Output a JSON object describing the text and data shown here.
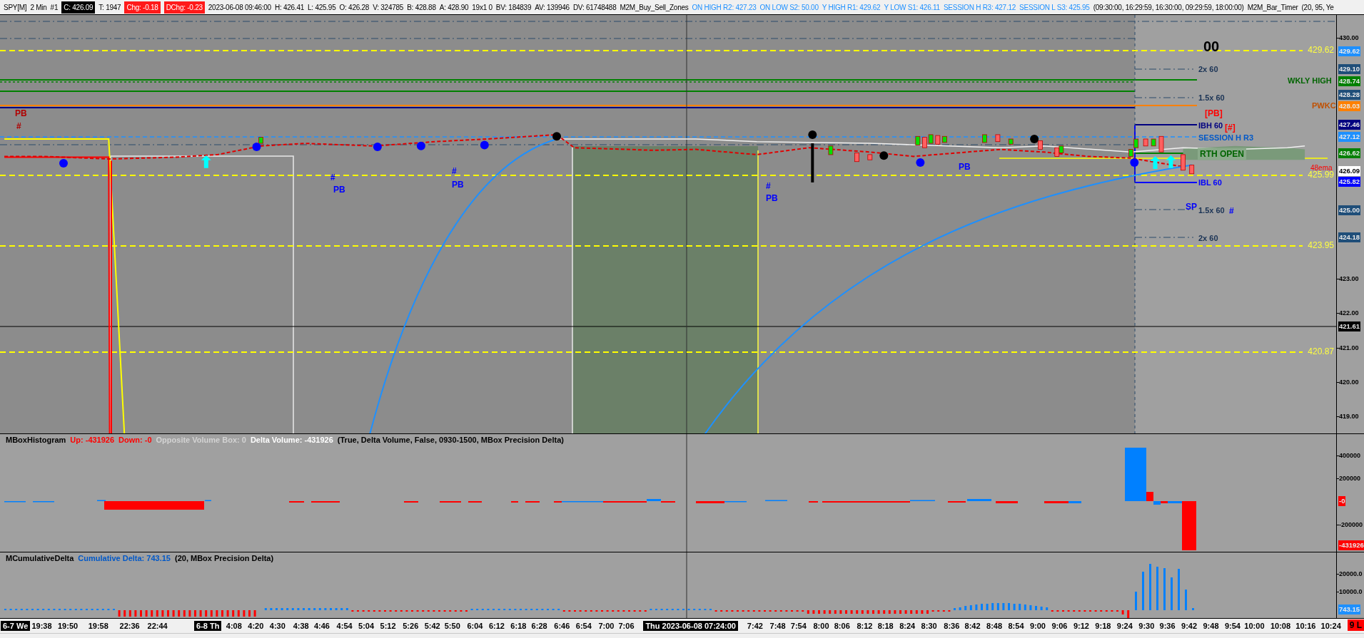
{
  "header": {
    "items": [
      {
        "text": "SPY[M]",
        "kind": "text"
      },
      {
        "text": "2 Min",
        "kind": "text"
      },
      {
        "text": "#1",
        "kind": "text"
      },
      {
        "text": "C: 426.09",
        "kind": "dark"
      },
      {
        "text": "T: 1947",
        "kind": "text"
      },
      {
        "text": "Chg: -0.18",
        "kind": "red"
      },
      {
        "text": "DChg: -0.23",
        "kind": "red"
      },
      {
        "text": "2023-06-08 09:46:00",
        "kind": "text"
      },
      {
        "text": "H: 426.41",
        "kind": "text"
      },
      {
        "text": "L: 425.95",
        "kind": "text"
      },
      {
        "text": "O: 426.28",
        "kind": "text"
      },
      {
        "text": "V: 324785",
        "kind": "text"
      },
      {
        "text": "B: 428.88",
        "kind": "text"
      },
      {
        "text": "A: 428.90",
        "kind": "text"
      },
      {
        "text": "19x1 0",
        "kind": "text"
      },
      {
        "text": "BV: 184839",
        "kind": "text"
      },
      {
        "text": "AV: 139946",
        "kind": "text"
      },
      {
        "text": "DV: 61748488",
        "kind": "text"
      },
      {
        "text": "M2M_Buy_Sell_Zones",
        "kind": "text"
      },
      {
        "text": "ON HIGH R2: 427.23",
        "kind": "blue"
      },
      {
        "text": "ON LOW S2: 50.00",
        "kind": "blue"
      },
      {
        "text": "Y HIGH R1: 429.62",
        "kind": "blue"
      },
      {
        "text": "Y LOW S1: 426.11",
        "kind": "blue"
      },
      {
        "text": "SESSION H R3: 427.12",
        "kind": "blue"
      },
      {
        "text": "SESSION L S3: 425.95",
        "kind": "blue"
      },
      {
        "text": "(09:30:00, 16:29:59, 16:30:00, 09:29:59, 18:00:00)",
        "kind": "text"
      },
      {
        "text": "M2M_Bar_Timer",
        "kind": "text"
      },
      {
        "text": "(20, 95, Ye",
        "kind": "text"
      }
    ]
  },
  "price_pane": {
    "axis_ticks": [
      "430.00",
      "423.00",
      "422.00",
      "421.00",
      "420.00",
      "419.00"
    ],
    "price_badges": [
      {
        "text": "429.62",
        "color": "#1e90ff"
      },
      {
        "text": "429.10",
        "color": "#1f4e79"
      },
      {
        "text": "428.74",
        "color": "#008000"
      },
      {
        "text": "428.28",
        "color": "#1f4e79"
      },
      {
        "text": "428.03",
        "color": "#ff8000"
      },
      {
        "text": "427.46",
        "color": "#000080"
      },
      {
        "text": "427.12",
        "color": "#1e90ff"
      },
      {
        "text": "426.62",
        "color": "#008000"
      },
      {
        "text": "426.09",
        "color": "#ffffff"
      },
      {
        "text": "425.82",
        "color": "#0000ff"
      },
      {
        "text": "425.00",
        "color": "#1f4e79"
      },
      {
        "text": "424.18",
        "color": "#1f4e79"
      },
      {
        "text": "421.61",
        "color": "#000000"
      }
    ],
    "level_lines": [
      {
        "label": "429.62"
      },
      {
        "label": "425.99"
      },
      {
        "label": "423.95"
      },
      {
        "label": "420.87"
      }
    ],
    "labels": [
      {
        "text": "PB",
        "color": "#b00000",
        "kind": "bold"
      },
      {
        "text": "#",
        "color": "#b00000",
        "kind": "bold"
      },
      {
        "text": "#",
        "color": "#0000ff",
        "kind": "bold"
      },
      {
        "text": "PB",
        "color": "#0000ff",
        "kind": "bold"
      },
      {
        "text": "#",
        "color": "#0000ff",
        "kind": "bold"
      },
      {
        "text": "PB",
        "color": "#0000ff",
        "kind": "bold"
      },
      {
        "text": "#",
        "color": "#0000ff",
        "kind": "bold"
      },
      {
        "text": "PB",
        "color": "#0000ff",
        "kind": "bold"
      },
      {
        "text": "PB",
        "color": "#0000ff",
        "kind": "bold"
      },
      {
        "text": "00",
        "color": "#000000",
        "kind": "big"
      },
      {
        "text": "2x 60",
        "color": "#1a3355",
        "kind": "plain"
      },
      {
        "text": "WKLY HIGH",
        "color": "#006400",
        "kind": "plain"
      },
      {
        "text": "1.5x 60",
        "color": "#1a3355",
        "kind": "plain"
      },
      {
        "text": "PWKC",
        "color": "#c05000",
        "kind": "plain"
      },
      {
        "text": "[PB]",
        "color": "#ff0000",
        "kind": "bold"
      },
      {
        "text": "IBH 60",
        "color": "#000080",
        "kind": "plain"
      },
      {
        "text": "[#]",
        "color": "#ff0000",
        "kind": "bold"
      },
      {
        "text": "SESSION H R3",
        "color": "#0058c8",
        "kind": "plain"
      },
      {
        "text": "RTH OPEN",
        "color": "#006400",
        "kind": "boxed"
      },
      {
        "text": "48ema",
        "color": "#ff0000",
        "kind": "small"
      },
      {
        "text": "IBL 60",
        "color": "#0000ff",
        "kind": "plain"
      },
      {
        "text": "SP",
        "color": "#0000ff",
        "kind": "bold"
      },
      {
        "text": "1.5x 60",
        "color": "#1a3355",
        "kind": "plain"
      },
      {
        "text": "#",
        "color": "#0000ff",
        "kind": "bold"
      },
      {
        "text": "2x 60",
        "color": "#1a3355",
        "kind": "plain"
      }
    ]
  },
  "histogram_pane": {
    "title_parts": [
      {
        "text": "MBoxHistogram",
        "color": "#000000"
      },
      {
        "text": "Up: -431926",
        "color": "#ff0000"
      },
      {
        "text": "Down: -0",
        "color": "#ff0000"
      },
      {
        "text": "Opposite Volume Box: 0",
        "color": "#d3d3d3"
      },
      {
        "text": "Delta Volume: -431926",
        "color": "#ffffff"
      },
      {
        "text": "(True, Delta Volume, False, 0930-1500, MBox Precision Delta)",
        "color": "#000000"
      }
    ],
    "axis_labels": [
      {
        "text": "400000",
        "kind": "tick"
      },
      {
        "text": "200000",
        "kind": "tick"
      },
      {
        "text": "-0",
        "kind": "badge"
      },
      {
        "text": "-200000",
        "kind": "tick"
      },
      {
        "text": "-431926",
        "kind": "badge"
      }
    ]
  },
  "cumulative_pane": {
    "title_parts": [
      {
        "text": "MCumulativeDelta",
        "color": "#000000"
      },
      {
        "text": "Cumulative Delta: 743.15",
        "color": "#0058c8"
      },
      {
        "text": "(20, MBox Precision Delta)",
        "color": "#000000"
      }
    ],
    "axis_labels": [
      {
        "text": "20000.0",
        "kind": "tick"
      },
      {
        "text": "10000.0",
        "kind": "tick"
      },
      {
        "text": "743.15",
        "kind": "badge"
      }
    ]
  },
  "time_axis": {
    "labels": [
      {
        "text": "6-7 We",
        "kind": "date"
      },
      {
        "text": "19:38",
        "kind": "time"
      },
      {
        "text": "19:50",
        "kind": "time"
      },
      {
        "text": "19:58",
        "kind": "time"
      },
      {
        "text": "22:36",
        "kind": "time"
      },
      {
        "text": "22:44",
        "kind": "time"
      },
      {
        "text": "6-8 Th",
        "kind": "date"
      },
      {
        "text": "4:08",
        "kind": "time"
      },
      {
        "text": "4:20",
        "kind": "time"
      },
      {
        "text": "4:30",
        "kind": "time"
      },
      {
        "text": "4:38",
        "kind": "time"
      },
      {
        "text": "4:46",
        "kind": "time"
      },
      {
        "text": "4:54",
        "kind": "time"
      },
      {
        "text": "5:04",
        "kind": "time"
      },
      {
        "text": "5:12",
        "kind": "time"
      },
      {
        "text": "5:26",
        "kind": "time"
      },
      {
        "text": "5:42",
        "kind": "time"
      },
      {
        "text": "5:50",
        "kind": "time"
      },
      {
        "text": "6:04",
        "kind": "time"
      },
      {
        "text": "6:12",
        "kind": "time"
      },
      {
        "text": "6:18",
        "kind": "time"
      },
      {
        "text": "6:28",
        "kind": "time"
      },
      {
        "text": "6:46",
        "kind": "time"
      },
      {
        "text": "6:54",
        "kind": "time"
      },
      {
        "text": "7:00",
        "kind": "time"
      },
      {
        "text": "7:06",
        "kind": "time"
      },
      {
        "text": "Thu 2023-06-08 07:24:00",
        "kind": "date"
      },
      {
        "text": "7:42",
        "kind": "time"
      },
      {
        "text": "7:48",
        "kind": "time"
      },
      {
        "text": "7:54",
        "kind": "time"
      },
      {
        "text": "8:00",
        "kind": "time"
      },
      {
        "text": "8:06",
        "kind": "time"
      },
      {
        "text": "8:12",
        "kind": "time"
      },
      {
        "text": "8:18",
        "kind": "time"
      },
      {
        "text": "8:24",
        "kind": "time"
      },
      {
        "text": "8:30",
        "kind": "time"
      },
      {
        "text": "8:36",
        "kind": "time"
      },
      {
        "text": "8:42",
        "kind": "time"
      },
      {
        "text": "8:48",
        "kind": "time"
      },
      {
        "text": "8:54",
        "kind": "time"
      },
      {
        "text": "9:00",
        "kind": "time"
      },
      {
        "text": "9:06",
        "kind": "time"
      },
      {
        "text": "9:12",
        "kind": "time"
      },
      {
        "text": "9:18",
        "kind": "time"
      },
      {
        "text": "9:24",
        "kind": "time"
      },
      {
        "text": "9:30",
        "kind": "time"
      },
      {
        "text": "9:36",
        "kind": "time"
      },
      {
        "text": "9:42",
        "kind": "time"
      },
      {
        "text": "9:48",
        "kind": "time"
      },
      {
        "text": "9:54",
        "kind": "time"
      },
      {
        "text": "10:00",
        "kind": "time"
      },
      {
        "text": "10:08",
        "kind": "time"
      },
      {
        "text": "10:16",
        "kind": "time"
      },
      {
        "text": "10:24",
        "kind": "time"
      }
    ],
    "corner_badge": "9 L"
  }
}
